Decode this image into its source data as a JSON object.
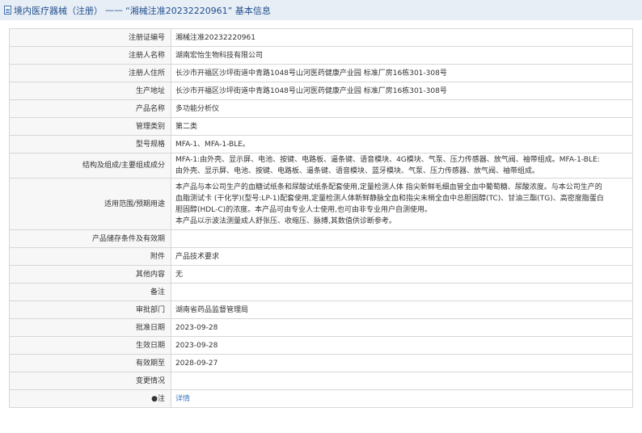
{
  "header": {
    "crumb": "境内医疗器械（注册）",
    "dash": "——",
    "title": "“湘械注准20232220961” 基本信息"
  },
  "rows": [
    {
      "label": "注册证编号",
      "value": "湘械注准20232220961"
    },
    {
      "label": "注册人名称",
      "value": "湖南宏怡生物科技有限公司"
    },
    {
      "label": "注册人住所",
      "value": "长沙市开福区沙坪街道中青路1048号山河医药健康产业园 标准厂房16栋301-308号"
    },
    {
      "label": "生产地址",
      "value": "长沙市开福区沙坪街道中青路1048号山河医药健康产业园 标准厂房16栋301-308号"
    },
    {
      "label": "产品名称",
      "value": "多功能分析仪"
    },
    {
      "label": "管理类别",
      "value": "第二类"
    },
    {
      "label": "型号规格",
      "value": "MFA-1、MFA-1-BLE。"
    },
    {
      "label": "结构及组成/主要组成成分",
      "value": "MFA-1:由外壳、显示屏、电池、按键、电路板、逼条键、语音模块、4G模块、气泵、压力传感器、放气阀、袖带组成。MFA-1-BLE:\n由外壳、显示屏、电池、按键、电路板、逼条键、语音模块、蓝牙模块、气泵、压力传感器、放气阀、袖带组成。"
    },
    {
      "label": "适用范围/预期用途",
      "value": "本产品与本公司生产的血糖试纸条和尿酸试纸条配套使用,定量检测人体 指尖新鲜毛细血管全血中葡萄糖、尿酸浓度。与本公司生产的\n血脂测试卡 (干化学)(型号:LP-1)配套使用,定量检测人体新鲜静脉全血和指尖末梢全血中总胆固醇(TC)、甘油三酯(TG)、高密度脂蛋白\n胆固醇(HDL-C)的浓度。本产品可由专业人士使用,也可由非专业用户自测使用。\n本产品以示波法测量成人舒张压、收缩压、脉搏,其数值供诊断参考。"
    },
    {
      "label": "产品储存条件及有效期",
      "value": ""
    },
    {
      "label": "附件",
      "value": "产品技术要求"
    },
    {
      "label": "其他内容",
      "value": "无"
    },
    {
      "label": "备注",
      "value": ""
    },
    {
      "label": "审批部门",
      "value": "湖南省药品监督管理局"
    },
    {
      "label": "批准日期",
      "value": "2023-09-28"
    },
    {
      "label": "生效日期",
      "value": "2023-09-28"
    },
    {
      "label": "有效期至",
      "value": "2028-09-27"
    },
    {
      "label": "变更情况",
      "value": ""
    },
    {
      "label": "●注",
      "value": "详情"
    }
  ]
}
